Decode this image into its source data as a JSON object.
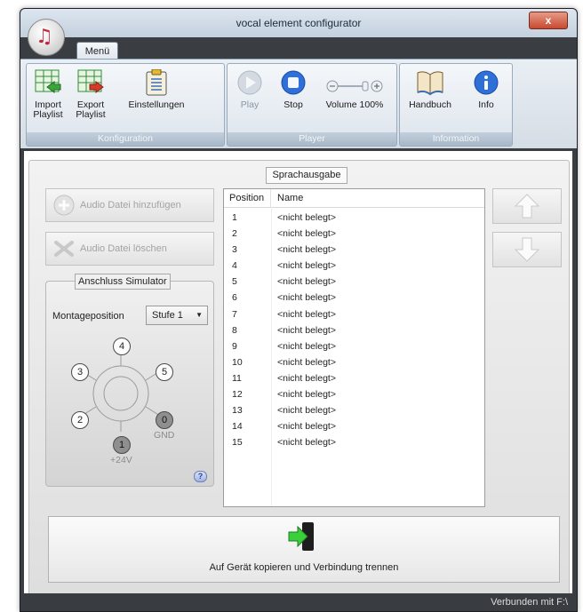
{
  "window": {
    "title": "vocal element configurator",
    "close_glyph": "x"
  },
  "menu_tab": {
    "label": "Menü"
  },
  "ribbon": {
    "groups": [
      {
        "label": "Konfiguration",
        "buttons": [
          {
            "label": "Import\nPlaylist",
            "icon": "import-playlist-icon"
          },
          {
            "label": "Export\nPlaylist",
            "icon": "export-playlist-icon"
          },
          {
            "label": "Einstellungen",
            "icon": "settings-clipboard-icon"
          }
        ]
      },
      {
        "label": "Player",
        "buttons": [
          {
            "label": "Play",
            "icon": "play-icon",
            "enabled": false
          },
          {
            "label": "Stop",
            "icon": "stop-icon"
          },
          {
            "label": "Volume 100%",
            "icon": "volume-slider-icon"
          }
        ]
      },
      {
        "label": "Information",
        "buttons": [
          {
            "label": "Handbuch",
            "icon": "book-icon"
          },
          {
            "label": "Info",
            "icon": "info-icon"
          }
        ]
      }
    ]
  },
  "main": {
    "header": "Sprachausgabe",
    "add_button": "Audio Datei hinzufügen",
    "delete_button": "Audio Datei löschen",
    "simulator": {
      "title": "Anschluss Simulator",
      "mount_label": "Montageposition",
      "mount_value": "Stufe 1",
      "pins": [
        "4",
        "3",
        "5",
        "2",
        "0",
        "1"
      ],
      "gnd_label": "GND",
      "v24_label": "+24V",
      "help_glyph": "?"
    },
    "list": {
      "columns": [
        "Position",
        "Name"
      ],
      "rows": [
        {
          "pos": "1",
          "name": "<nicht belegt>"
        },
        {
          "pos": "2",
          "name": "<nicht belegt>"
        },
        {
          "pos": "3",
          "name": "<nicht belegt>"
        },
        {
          "pos": "4",
          "name": "<nicht belegt>"
        },
        {
          "pos": "5",
          "name": "<nicht belegt>"
        },
        {
          "pos": "6",
          "name": "<nicht belegt>"
        },
        {
          "pos": "7",
          "name": "<nicht belegt>"
        },
        {
          "pos": "8",
          "name": "<nicht belegt>"
        },
        {
          "pos": "9",
          "name": "<nicht belegt>"
        },
        {
          "pos": "10",
          "name": "<nicht belegt>"
        },
        {
          "pos": "11",
          "name": "<nicht belegt>"
        },
        {
          "pos": "12",
          "name": "<nicht belegt>"
        },
        {
          "pos": "13",
          "name": "<nicht belegt>"
        },
        {
          "pos": "14",
          "name": "<nicht belegt>"
        },
        {
          "pos": "15",
          "name": "<nicht belegt>"
        }
      ]
    },
    "copy_button": "Auf Gerät kopieren und Verbindung trennen"
  },
  "status": {
    "text": "Verbunden mit F:\\"
  },
  "colors": {
    "frame": "#3a3d42",
    "ribbon_label": "#a8b8c9",
    "accent_blue": "#2f6fd8",
    "accent_green": "#3aa63a"
  }
}
